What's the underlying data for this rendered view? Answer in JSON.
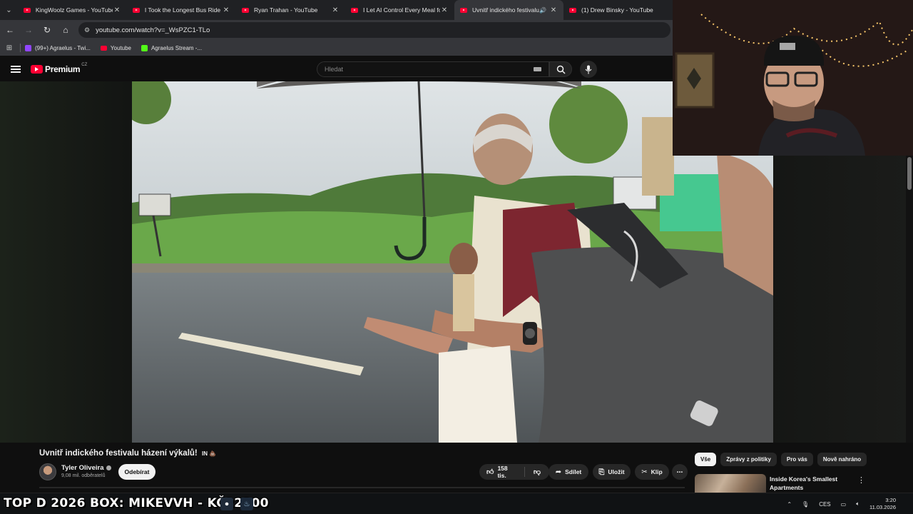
{
  "browser": {
    "tabs": [
      {
        "title": "KingWoolz Games - YouTube",
        "active": false
      },
      {
        "title": "I Took the Longest Bus Ride in ",
        "active": false
      },
      {
        "title": "Ryan Trahan - YouTube",
        "active": false
      },
      {
        "title": "I Let AI Control Every Meal for ",
        "active": false
      },
      {
        "title": "Uvnitř indického festivalu h",
        "active": true
      },
      {
        "title": "(1) Drew Binsky - YouTube",
        "active": false
      }
    ],
    "url": "youtube.com/watch?v=_WsPZC1-TLo",
    "bookmarks": [
      {
        "label": "(99+) Agraelus - Twi...",
        "color": "#9146ff"
      },
      {
        "label": "Youtube",
        "color": "#ff0033"
      },
      {
        "label": "Agraelus Stream -...",
        "color": "#53fc18"
      }
    ]
  },
  "youtube": {
    "logo_text": "Premium",
    "country": "CZ",
    "search_placeholder": "Hledat",
    "video_title": "Uvnitř indického festivalu házení výkalů!",
    "title_flags": "IN 💩",
    "channel_name": "Tyler Oliveira",
    "subscribers": "9,08 mil. odběratelů",
    "subscribe_label": "Odebírat",
    "likes": "158 tis.",
    "share_label": "Sdílet",
    "save_label": "Uložit",
    "clip_label": "Klip",
    "chips": [
      "Vše",
      "Zprávy z politiky",
      "Pro vás",
      "Nově nahráno"
    ],
    "recommendation_title": "Inside Korea's Smallest Apartments"
  },
  "taskbar": {
    "ticker": "TOP D 2026 BOX: MIKEVVH - KČ22300",
    "language": "CES",
    "time": "3:20",
    "date": "11.03.2026"
  },
  "colors": {
    "yt_red": "#ff0033",
    "background": "#0f0f0f",
    "surface": "#272727"
  }
}
